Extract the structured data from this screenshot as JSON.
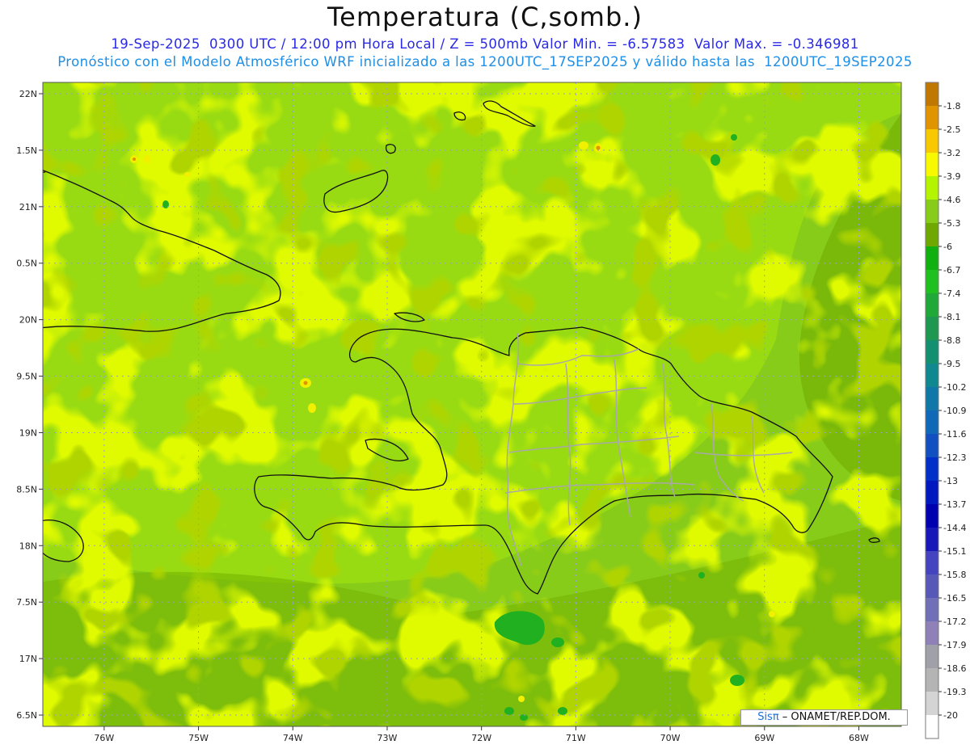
{
  "header": {
    "title": "Temperatura (C,somb.)",
    "subtitle1": "19-Sep-2025  0300 UTC / 12:00 pm Hora Local / Z = 500mb Valor Min. = -6.57583  Valor Max. = -0.346981",
    "subtitle2": "Pronóstico con el Modelo Atmosférico WRF inicializado a las 1200UTC_17SEP2025 y válido hasta las  1200UTC_19SEP2025"
  },
  "map": {
    "lon_range": [
      -76.65,
      -67.55
    ],
    "lat_range": [
      16.4,
      22.1
    ],
    "lon_ticks": [
      {
        "value": -76,
        "label": "76W"
      },
      {
        "value": -75,
        "label": "75W"
      },
      {
        "value": -74,
        "label": "74W"
      },
      {
        "value": -73,
        "label": "73W"
      },
      {
        "value": -72,
        "label": "72W"
      },
      {
        "value": -71,
        "label": "71W"
      },
      {
        "value": -70,
        "label": "70W"
      },
      {
        "value": -69,
        "label": "69W"
      },
      {
        "value": -68,
        "label": "68W"
      }
    ],
    "lat_ticks": [
      {
        "value": 22,
        "label": "22N"
      },
      {
        "value": 21.5,
        "label": "1.5N"
      },
      {
        "value": 21,
        "label": "21N"
      },
      {
        "value": 20.5,
        "label": "0.5N"
      },
      {
        "value": 20,
        "label": "20N"
      },
      {
        "value": 19.5,
        "label": "9.5N"
      },
      {
        "value": 19,
        "label": "19N"
      },
      {
        "value": 18.5,
        "label": "8.5N"
      },
      {
        "value": 18,
        "label": "18N"
      },
      {
        "value": 17.5,
        "label": "7.5N"
      },
      {
        "value": 17,
        "label": "17N"
      },
      {
        "value": 16.5,
        "label": "6.5N"
      }
    ],
    "grid": true,
    "background_color": "#88cc1a"
  },
  "colorbar": {
    "labels": [
      "-1.8",
      "-2.5",
      "-3.2",
      "-3.9",
      "-4.6",
      "-5.3",
      "-6",
      "-6.7",
      "-7.4",
      "-8.1",
      "-8.8",
      "-9.5",
      "-10.2",
      "-10.9",
      "-11.6",
      "-12.3",
      "-13",
      "-13.7",
      "-14.4",
      "-15.1",
      "-15.8",
      "-16.5",
      "-17.2",
      "-17.9",
      "-18.6",
      "-19.3",
      "-20"
    ],
    "colors": [
      "#c07800",
      "#e09400",
      "#f8c800",
      "#f8f800",
      "#b4f400",
      "#88cc1a",
      "#6ea800",
      "#10b010",
      "#20c020",
      "#20a838",
      "#1e9850",
      "#129070",
      "#108890",
      "#1078a8",
      "#1068b8",
      "#1050c0",
      "#0030c8",
      "#0018c0",
      "#0000b0",
      "#1818b8",
      "#4444c0",
      "#5858b8",
      "#7070b8",
      "#9080b8",
      "#a0a0a8",
      "#b4b4b4",
      "#d4d4d4",
      "#ffffff"
    ]
  },
  "credit": {
    "sis": "Sisπ",
    "text": " – ONAMET/REP.DOM."
  }
}
